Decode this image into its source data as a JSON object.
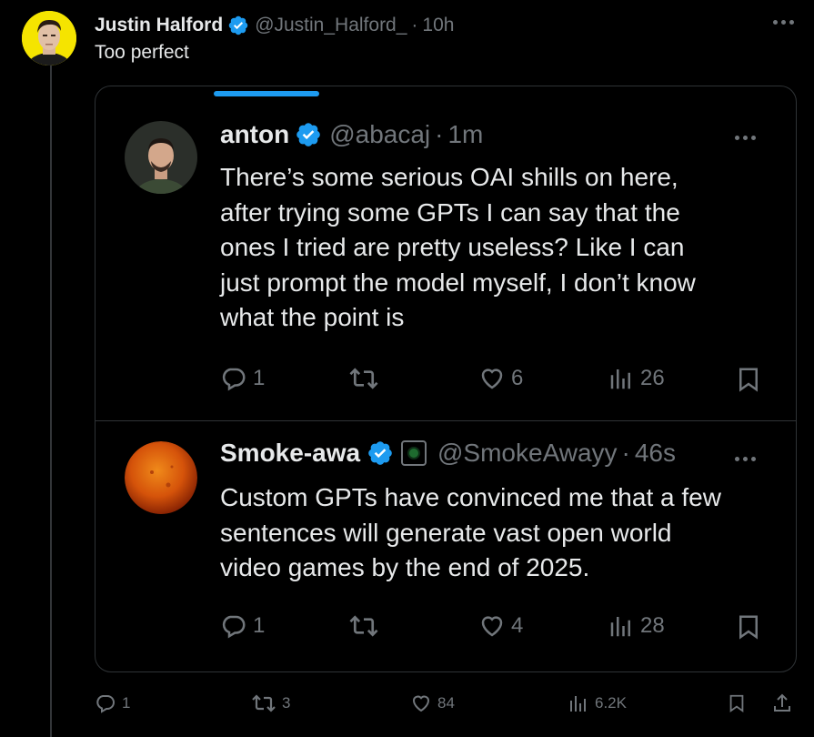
{
  "tweet": {
    "author_name": "Justin Halford",
    "handle": "@Justin_Halford_",
    "time": "10h",
    "text": "Too perfect",
    "stats": {
      "replies": "1",
      "retweets": "3",
      "likes": "84",
      "views": "6.2K"
    }
  },
  "quote": {
    "progress": 0.15,
    "tweets": [
      {
        "author_name": "anton",
        "handle": "@abacaj",
        "time": "1m",
        "lines": [
          "There’s some serious OAI shills on here,",
          "after trying some GPTs I can say that the",
          "ones I tried are pretty useless? Like I can",
          "just prompt the model myself, I don’t know",
          "what the point is"
        ],
        "stats": {
          "replies": "1",
          "likes": "6",
          "views": "26"
        }
      },
      {
        "author_name": "Smoke-awa",
        "handle": "@SmokeAwayy",
        "time": "46s",
        "lines": [
          "Custom GPTs have convinced me that a few",
          "sentences will generate vast open world",
          "video games by the end of 2025."
        ],
        "stats": {
          "replies": "1",
          "likes": "4",
          "views": "28"
        }
      }
    ]
  },
  "colors": {
    "accent": "#1d9bf0",
    "muted": "#71767b",
    "border": "#2f3336",
    "text": "#e7e9ea",
    "avatar_bg": "#f5e400"
  },
  "icons": [
    "verified-badge-icon",
    "more-icon",
    "reply-icon",
    "retweet-icon",
    "like-icon",
    "views-icon",
    "bookmark-icon",
    "share-icon"
  ]
}
